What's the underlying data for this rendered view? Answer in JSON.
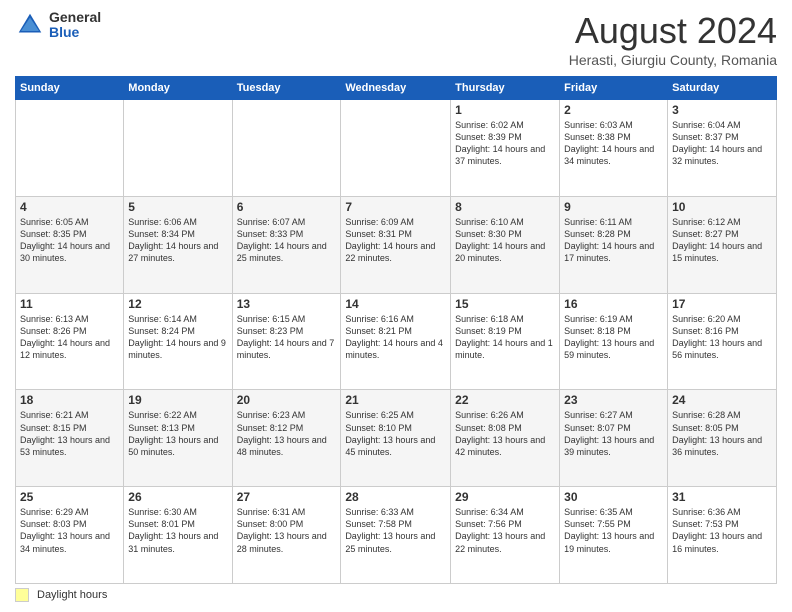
{
  "header": {
    "logo_general": "General",
    "logo_blue": "Blue",
    "month_title": "August 2024",
    "location": "Herasti, Giurgiu County, Romania"
  },
  "weekdays": [
    "Sunday",
    "Monday",
    "Tuesday",
    "Wednesday",
    "Thursday",
    "Friday",
    "Saturday"
  ],
  "footer": {
    "daylight_label": "Daylight hours"
  },
  "weeks": [
    [
      {
        "day": "",
        "info": ""
      },
      {
        "day": "",
        "info": ""
      },
      {
        "day": "",
        "info": ""
      },
      {
        "day": "",
        "info": ""
      },
      {
        "day": "1",
        "info": "Sunrise: 6:02 AM\nSunset: 8:39 PM\nDaylight: 14 hours\nand 37 minutes."
      },
      {
        "day": "2",
        "info": "Sunrise: 6:03 AM\nSunset: 8:38 PM\nDaylight: 14 hours\nand 34 minutes."
      },
      {
        "day": "3",
        "info": "Sunrise: 6:04 AM\nSunset: 8:37 PM\nDaylight: 14 hours\nand 32 minutes."
      }
    ],
    [
      {
        "day": "4",
        "info": "Sunrise: 6:05 AM\nSunset: 8:35 PM\nDaylight: 14 hours\nand 30 minutes."
      },
      {
        "day": "5",
        "info": "Sunrise: 6:06 AM\nSunset: 8:34 PM\nDaylight: 14 hours\nand 27 minutes."
      },
      {
        "day": "6",
        "info": "Sunrise: 6:07 AM\nSunset: 8:33 PM\nDaylight: 14 hours\nand 25 minutes."
      },
      {
        "day": "7",
        "info": "Sunrise: 6:09 AM\nSunset: 8:31 PM\nDaylight: 14 hours\nand 22 minutes."
      },
      {
        "day": "8",
        "info": "Sunrise: 6:10 AM\nSunset: 8:30 PM\nDaylight: 14 hours\nand 20 minutes."
      },
      {
        "day": "9",
        "info": "Sunrise: 6:11 AM\nSunset: 8:28 PM\nDaylight: 14 hours\nand 17 minutes."
      },
      {
        "day": "10",
        "info": "Sunrise: 6:12 AM\nSunset: 8:27 PM\nDaylight: 14 hours\nand 15 minutes."
      }
    ],
    [
      {
        "day": "11",
        "info": "Sunrise: 6:13 AM\nSunset: 8:26 PM\nDaylight: 14 hours\nand 12 minutes."
      },
      {
        "day": "12",
        "info": "Sunrise: 6:14 AM\nSunset: 8:24 PM\nDaylight: 14 hours\nand 9 minutes."
      },
      {
        "day": "13",
        "info": "Sunrise: 6:15 AM\nSunset: 8:23 PM\nDaylight: 14 hours\nand 7 minutes."
      },
      {
        "day": "14",
        "info": "Sunrise: 6:16 AM\nSunset: 8:21 PM\nDaylight: 14 hours\nand 4 minutes."
      },
      {
        "day": "15",
        "info": "Sunrise: 6:18 AM\nSunset: 8:19 PM\nDaylight: 14 hours\nand 1 minute."
      },
      {
        "day": "16",
        "info": "Sunrise: 6:19 AM\nSunset: 8:18 PM\nDaylight: 13 hours\nand 59 minutes."
      },
      {
        "day": "17",
        "info": "Sunrise: 6:20 AM\nSunset: 8:16 PM\nDaylight: 13 hours\nand 56 minutes."
      }
    ],
    [
      {
        "day": "18",
        "info": "Sunrise: 6:21 AM\nSunset: 8:15 PM\nDaylight: 13 hours\nand 53 minutes."
      },
      {
        "day": "19",
        "info": "Sunrise: 6:22 AM\nSunset: 8:13 PM\nDaylight: 13 hours\nand 50 minutes."
      },
      {
        "day": "20",
        "info": "Sunrise: 6:23 AM\nSunset: 8:12 PM\nDaylight: 13 hours\nand 48 minutes."
      },
      {
        "day": "21",
        "info": "Sunrise: 6:25 AM\nSunset: 8:10 PM\nDaylight: 13 hours\nand 45 minutes."
      },
      {
        "day": "22",
        "info": "Sunrise: 6:26 AM\nSunset: 8:08 PM\nDaylight: 13 hours\nand 42 minutes."
      },
      {
        "day": "23",
        "info": "Sunrise: 6:27 AM\nSunset: 8:07 PM\nDaylight: 13 hours\nand 39 minutes."
      },
      {
        "day": "24",
        "info": "Sunrise: 6:28 AM\nSunset: 8:05 PM\nDaylight: 13 hours\nand 36 minutes."
      }
    ],
    [
      {
        "day": "25",
        "info": "Sunrise: 6:29 AM\nSunset: 8:03 PM\nDaylight: 13 hours\nand 34 minutes."
      },
      {
        "day": "26",
        "info": "Sunrise: 6:30 AM\nSunset: 8:01 PM\nDaylight: 13 hours\nand 31 minutes."
      },
      {
        "day": "27",
        "info": "Sunrise: 6:31 AM\nSunset: 8:00 PM\nDaylight: 13 hours\nand 28 minutes."
      },
      {
        "day": "28",
        "info": "Sunrise: 6:33 AM\nSunset: 7:58 PM\nDaylight: 13 hours\nand 25 minutes."
      },
      {
        "day": "29",
        "info": "Sunrise: 6:34 AM\nSunset: 7:56 PM\nDaylight: 13 hours\nand 22 minutes."
      },
      {
        "day": "30",
        "info": "Sunrise: 6:35 AM\nSunset: 7:55 PM\nDaylight: 13 hours\nand 19 minutes."
      },
      {
        "day": "31",
        "info": "Sunrise: 6:36 AM\nSunset: 7:53 PM\nDaylight: 13 hours\nand 16 minutes."
      }
    ]
  ]
}
